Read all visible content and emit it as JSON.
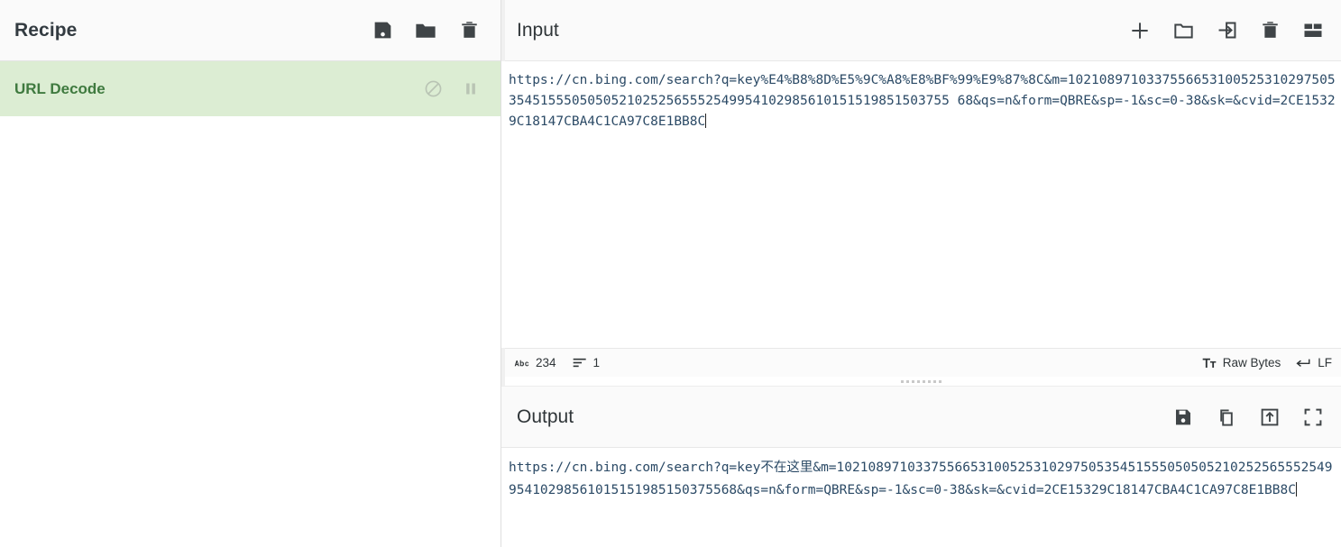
{
  "recipe": {
    "title": "Recipe",
    "icons": [
      {
        "name": "save-recipe-icon",
        "label": "Save recipe"
      },
      {
        "name": "load-recipe-icon",
        "label": "Load recipe"
      },
      {
        "name": "clear-recipe-icon",
        "label": "Clear recipe"
      }
    ],
    "operations": [
      {
        "name": "URL Decode",
        "disable_icon_label": "Disable operation",
        "breakpoint_icon_label": "Set breakpoint"
      }
    ]
  },
  "input": {
    "title": "Input",
    "icons": [
      {
        "name": "add-input-tab-icon",
        "label": "Add a new input"
      },
      {
        "name": "open-folder-icon",
        "label": "Open folder as input"
      },
      {
        "name": "open-file-icon",
        "label": "Open file as input"
      },
      {
        "name": "clear-input-icon",
        "label": "Clear input and output"
      },
      {
        "name": "reset-pane-layout-icon",
        "label": "Reset pane layout"
      }
    ],
    "value": "https://cn.bing.com/search?q=key%E4%B8%8D%E5%9C%A8%E8%BF%99%E9%87%8C&m=102108971033755665310052531029750535451555050505210252565552549954102985610151519851503755 68&qs=n&form=QBRE&sp=-1&sc=0-38&sk=&cvid=2CE15329C18147CBA4C1CA97C8E1BB8C",
    "placeholder": "Input",
    "status": {
      "length_icon": "abc-icon",
      "length": "234",
      "lines_icon": "lines-icon",
      "lines": "1",
      "encoding_icon": "font-icon",
      "encoding": "Raw Bytes",
      "eol_icon": "return-arrow-icon",
      "eol": "LF"
    }
  },
  "output": {
    "title": "Output",
    "icons": [
      {
        "name": "save-output-icon",
        "label": "Save output to file"
      },
      {
        "name": "copy-output-icon",
        "label": "Copy raw output to the clipboard"
      },
      {
        "name": "replace-input-icon",
        "label": "Replace input with output"
      },
      {
        "name": "maximise-output-icon",
        "label": "Maximise output pane"
      }
    ],
    "value": "https://cn.bing.com/search?q=key不在这里&m=10210897103375566531005253102975053545155505050521025256555254995410298561015151985150375568&qs=n&form=QBRE&sp=-1&sc=0-38&sk=&cvid=2CE15329C18147CBA4C1CA97C8E1BB8C"
  },
  "colors": {
    "recipe_op_bg": "#dcedd3",
    "recipe_op_text": "#3f7a3f",
    "editor_text": "#2b4a66",
    "title_bar_bg": "#fafafa"
  }
}
